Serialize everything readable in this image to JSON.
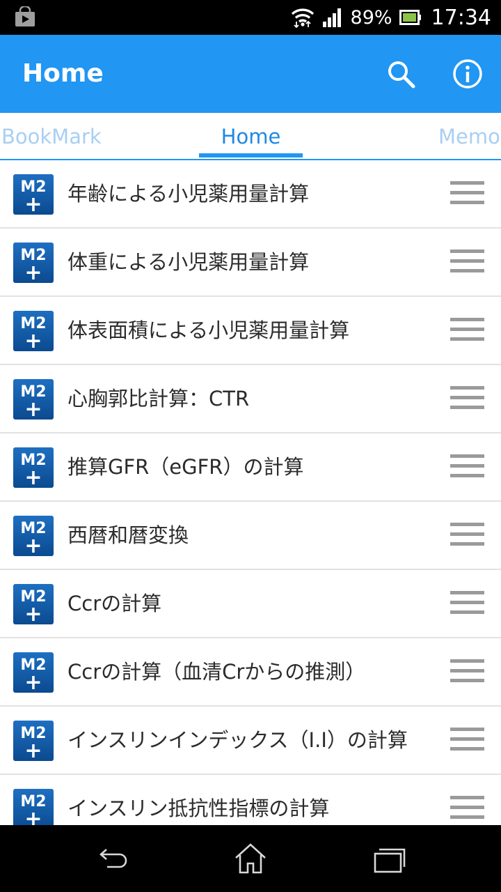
{
  "status_bar": {
    "battery": "89%",
    "time": "17:34",
    "icons": [
      "shopping-bag-icon",
      "wifi-icon",
      "signal-icon",
      "battery-icon"
    ]
  },
  "app_bar": {
    "title": "Home",
    "actions": [
      "search-icon",
      "info-icon"
    ],
    "color": "#2196f3"
  },
  "tabs": [
    {
      "label": "BookMark",
      "selected": false
    },
    {
      "label": "Home",
      "selected": true
    },
    {
      "label": "Memo",
      "selected": false
    }
  ],
  "list": {
    "icon_text": "M2",
    "icon_plus": "+",
    "items": [
      {
        "label": "年齢による小児薬用量計算"
      },
      {
        "label": "体重による小児薬用量計算"
      },
      {
        "label": "体表面積による小児薬用量計算"
      },
      {
        "label": "心胸郭比計算：CTR"
      },
      {
        "label": "推算GFR（eGFR）の計算"
      },
      {
        "label": "西暦和暦変換"
      },
      {
        "label": "Ccrの計算"
      },
      {
        "label": "Ccrの計算（血清Crからの推測）"
      },
      {
        "label": "インスリンインデックス（I.I）の計算"
      },
      {
        "label": "インスリン抵抗性指標の計算"
      }
    ]
  },
  "nav_bar": {
    "buttons": [
      "back-icon",
      "home-icon",
      "recents-icon"
    ]
  }
}
